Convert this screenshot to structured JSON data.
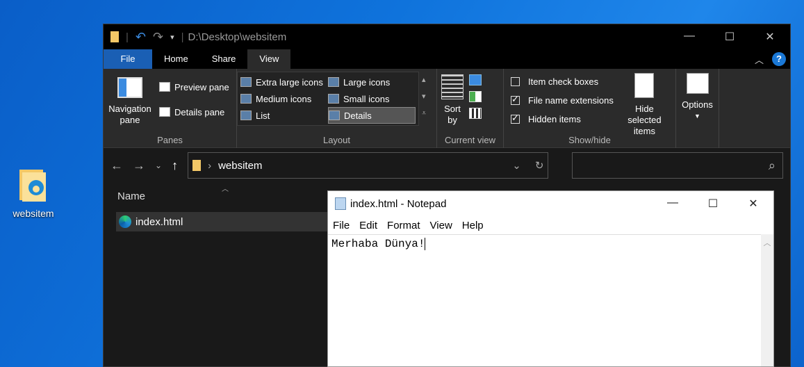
{
  "desktop": {
    "icon_label": "websitem"
  },
  "explorer": {
    "title_path": "D:\\Desktop\\websitem",
    "tabs": [
      "File",
      "Home",
      "Share",
      "View"
    ],
    "ribbon": {
      "panes": {
        "navigation": "Navigation",
        "navigation2": "pane",
        "preview": "Preview pane",
        "details": "Details pane",
        "label": "Panes"
      },
      "layout": {
        "items": [
          "Extra large icons",
          "Large icons",
          "Medium icons",
          "Small icons",
          "List",
          "Details"
        ],
        "label": "Layout"
      },
      "current_view": {
        "sort": "Sort",
        "sort2": "by",
        "label": "Current view"
      },
      "show_hide": {
        "item_check": "Item check boxes",
        "extensions": "File name extensions",
        "hidden": "Hidden items",
        "hide_selected": "Hide selected",
        "hide_selected2": "items",
        "label": "Show/hide"
      },
      "options": "Options"
    },
    "address": {
      "folder": "websitem"
    },
    "columns": {
      "name": "Name"
    },
    "files": [
      {
        "name": "index.html"
      }
    ]
  },
  "notepad": {
    "title": "index.html - Notepad",
    "menu": [
      "File",
      "Edit",
      "Format",
      "View",
      "Help"
    ],
    "content": "Merhaba Dünya!"
  }
}
